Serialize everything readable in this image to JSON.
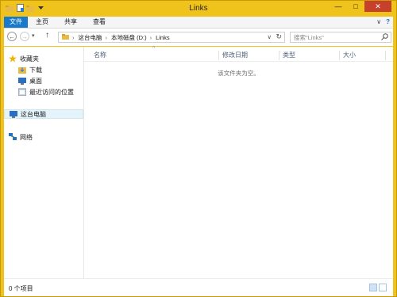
{
  "window": {
    "title": "Links"
  },
  "titlebar": {
    "quick_access_icons": [
      "folder-icon",
      "properties-icon",
      "new-folder-icon",
      "dropdown-icon"
    ]
  },
  "ribbon": {
    "tabs": [
      "文件",
      "主页",
      "共享",
      "查看"
    ],
    "file_tab_color": "#1979ca"
  },
  "address": {
    "segments": [
      "这台电脑",
      "本地磁盘 (D:)",
      "Links"
    ]
  },
  "search": {
    "placeholder": "搜索\"Links\""
  },
  "sidebar": {
    "favorites": {
      "label": "收藏夹"
    },
    "items": [
      {
        "label": "下载",
        "icon": "download-folder-icon"
      },
      {
        "label": "桌面",
        "icon": "desktop-icon"
      },
      {
        "label": "最近访问的位置",
        "icon": "recent-places-icon"
      }
    ],
    "this_pc": {
      "label": "这台电脑"
    },
    "network": {
      "label": "网络"
    }
  },
  "columns": [
    "名称",
    "修改日期",
    "类型",
    "大小"
  ],
  "empty_message": "该文件夹为空。",
  "status": {
    "item_count": "0 个项目"
  },
  "colors": {
    "frame": "#efc31b",
    "close_button": "#c7402c",
    "selection": "#e5f3fb"
  }
}
